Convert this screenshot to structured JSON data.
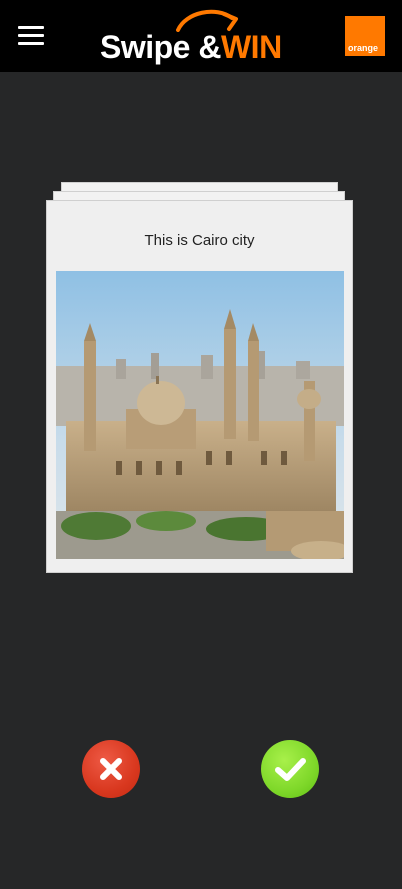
{
  "header": {
    "logo_swipe": "Swipe",
    "logo_amp": "&",
    "logo_win": "WIN",
    "brand_name": "orange"
  },
  "card": {
    "title": "This is Cairo city"
  },
  "colors": {
    "background": "#262728",
    "topbar": "#000000",
    "brand_orange": "#ff7900",
    "reject": "#d9381f",
    "accept": "#7fd82a"
  },
  "icons": {
    "menu": "hamburger-icon",
    "reject": "close-icon",
    "accept": "check-icon"
  }
}
